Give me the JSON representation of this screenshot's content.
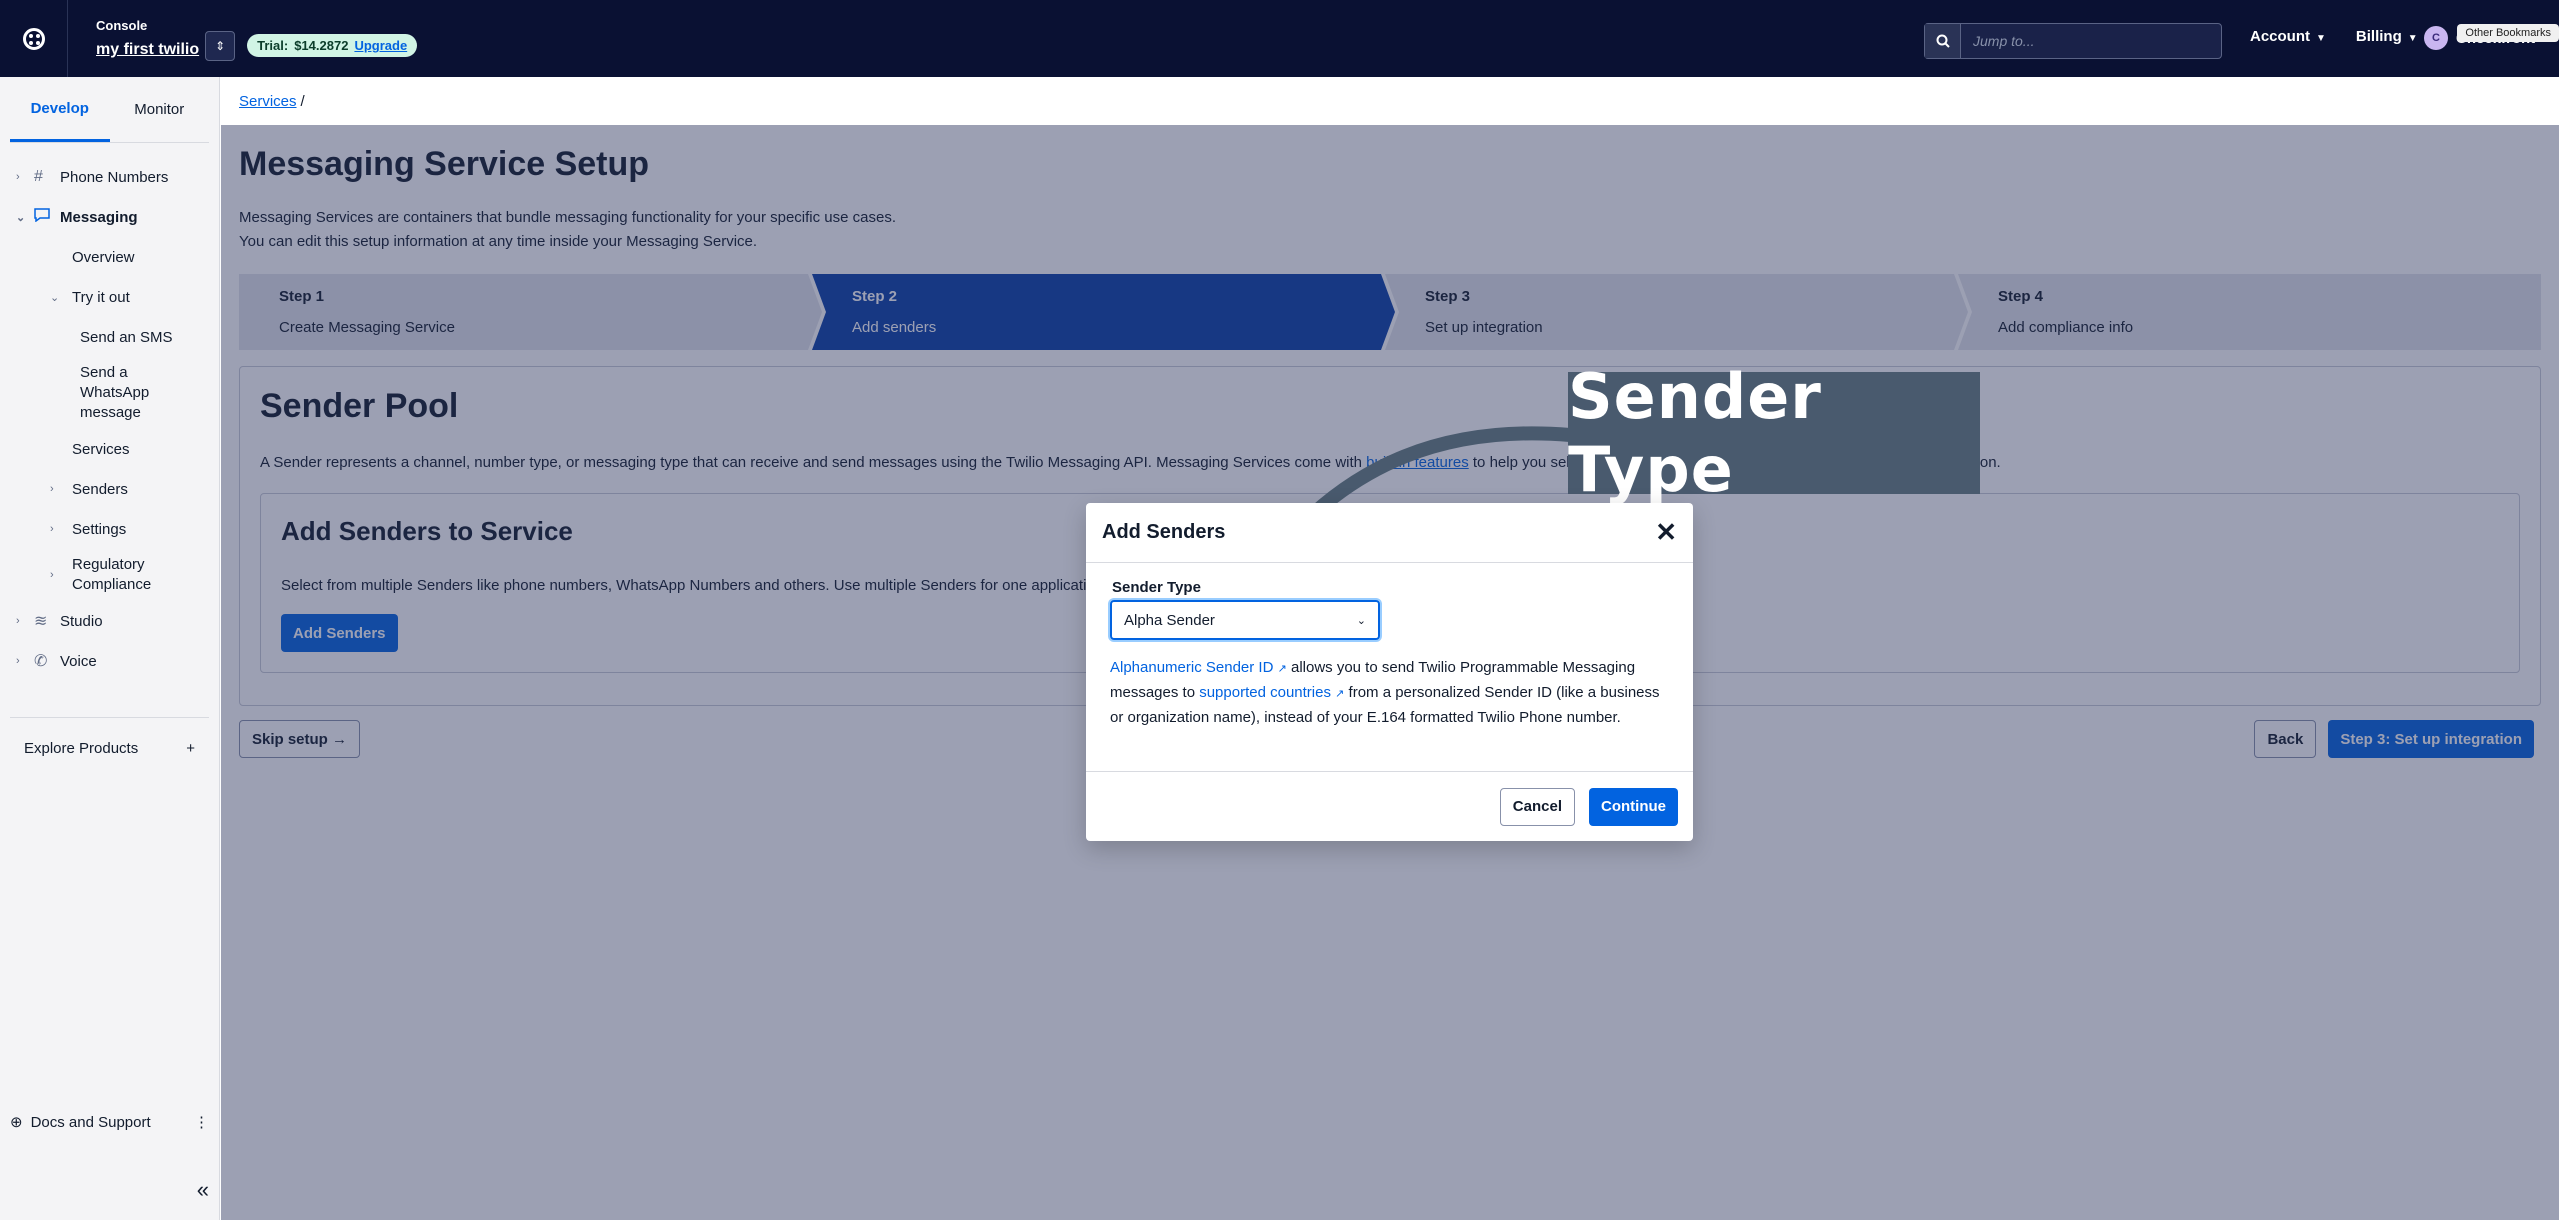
{
  "topbar": {
    "console_label": "Console",
    "account_name": "my first twilio",
    "trial_label": "Trial:",
    "trial_amount": "$14.2872",
    "upgrade_label": "Upgrade",
    "search_placeholder": "Jump to...",
    "nav": [
      {
        "label": "Account"
      },
      {
        "label": "Billing"
      }
    ],
    "user_initial": "C",
    "user_name": "Checkfront",
    "bookmarks_label": "Other Bookmarks"
  },
  "sidebar": {
    "tabs": [
      {
        "label": "Develop"
      },
      {
        "label": "Monitor"
      }
    ],
    "items": [
      {
        "label": "Phone Numbers"
      },
      {
        "label": "Messaging"
      },
      {
        "label": "Overview"
      },
      {
        "label": "Try it out"
      },
      {
        "label": "Send an SMS"
      },
      {
        "label": "Send a WhatsApp message"
      },
      {
        "label": "Services"
      },
      {
        "label": "Senders"
      },
      {
        "label": "Settings"
      },
      {
        "label": "Regulatory Compliance"
      },
      {
        "label": "Studio"
      },
      {
        "label": "Voice"
      }
    ],
    "explore_label": "Explore Products",
    "docs_label": "Docs and Support"
  },
  "main": {
    "breadcrumb_link": "Services",
    "breadcrumb_sep": "/",
    "title": "Messaging Service Setup",
    "lead_line1": "Messaging Services are containers that bundle messaging functionality for your specific use cases.",
    "lead_line2": "You can edit this setup information at any time inside your Messaging Service.",
    "steps": [
      {
        "num": "Step 1",
        "desc": "Create Messaging Service"
      },
      {
        "num": "Step 2",
        "desc": "Add senders"
      },
      {
        "num": "Step 3",
        "desc": "Set up integration"
      },
      {
        "num": "Step 4",
        "desc": "Add compliance info"
      }
    ],
    "pool_title": "Sender Pool",
    "pool_text_a": "A Sender represents a channel, number type, or messaging type that can receive and send messages using the Twilio Messaging API. Messaging Services come with ",
    "pool_link": "built-in features",
    "pool_text_b": " to help you select the best Sender for your use case and scale your application.",
    "card_title": "Add Senders to Service",
    "card_text": "Select from multiple Senders like phone numbers, WhatsApp Numbers and others. Use multiple Senders for one application",
    "add_senders_label": "Add Senders",
    "skip_label": "Skip setup",
    "back_label": "Back",
    "next_label": "Step 3: Set up integration"
  },
  "modal": {
    "title": "Add Senders",
    "field_label": "Sender Type",
    "select_value": "Alpha Sender",
    "help_link1": "Alphanumeric Sender ID",
    "help_text1": " allows you to send Twilio Programmable Messaging messages to ",
    "help_link2": "supported countries",
    "help_text2": " from a personalized Sender ID (like a business or organization name), instead of your E.164 formatted Twilio Phone number.",
    "cancel_label": "Cancel",
    "continue_label": "Continue"
  },
  "annotation": {
    "label": "Sender Type"
  },
  "colors": {
    "topbar_bg": "#0a1133",
    "primary": "#0263e0",
    "active_step": "#0b3fa6",
    "callout_bg": "#495a6e"
  }
}
